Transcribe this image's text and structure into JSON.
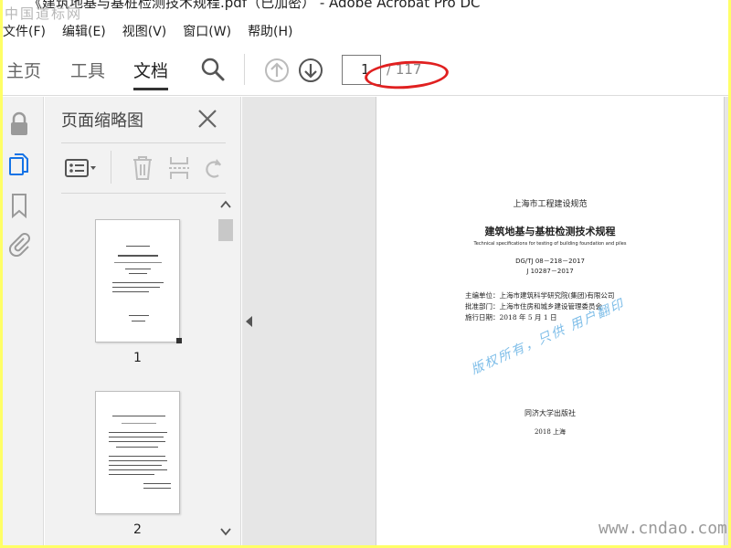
{
  "window": {
    "title": "《建筑地基与基桩检测技术规程.pdf（已加密） - Adobe Acrobat Pro DC",
    "top_watermark": "中国道标网"
  },
  "menu": [
    {
      "label": "文件(F)"
    },
    {
      "label": "编辑(E)"
    },
    {
      "label": "视图(V)"
    },
    {
      "label": "窗口(W)"
    },
    {
      "label": "帮助(H)"
    }
  ],
  "toolbar": {
    "tabs": [
      {
        "label": "主页"
      },
      {
        "label": "工具"
      },
      {
        "label": "文档"
      }
    ],
    "page_current": "1",
    "page_total": "/ 117"
  },
  "sidebar": {
    "panel_title": "页面缩略图",
    "thumbnails": [
      {
        "label": "1"
      },
      {
        "label": "2"
      }
    ]
  },
  "document": {
    "series": "上海市工程建设规范",
    "title": "建筑地基与基桩检测技术规程",
    "subtitle_en": "Technical specifications for testing of building foundation and piles",
    "code1": "DG/TJ 08－218－2017",
    "code2": "J 10287－2017",
    "editor": "主编单位：上海市建筑科学研究院(集团)有限公司",
    "approver": "批准部门：上海市住房和城乡建设管理委员会",
    "date": "施行日期：2018 年 5 月 1 日",
    "publisher": "同济大学出版社",
    "place_year": "2018  上海",
    "stamp": "版权所有，只供 用户翻印"
  },
  "watermark": {
    "site": "www.cndao.com"
  },
  "colors": {
    "border": "#ffff66",
    "highlight_ellipse": "#e02020",
    "stamp": "#6fb6e6"
  },
  "icons": [
    "search-icon",
    "arrow-up-icon",
    "arrow-down-icon",
    "lock-icon",
    "pages-icon",
    "bookmark-icon",
    "attachment-icon",
    "close-icon",
    "options-icon",
    "trash-icon",
    "extract-icon",
    "rotate-icon",
    "collapse-left-icon",
    "scroll-up-icon",
    "scroll-down-icon"
  ]
}
